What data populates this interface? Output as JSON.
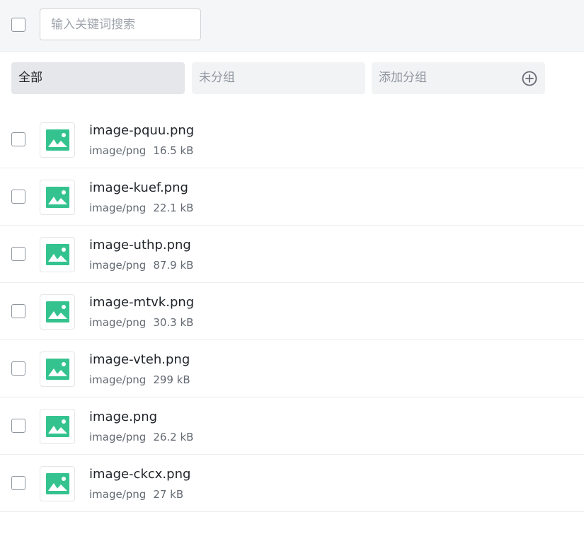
{
  "search": {
    "placeholder": "输入关键词搜索"
  },
  "groups": {
    "all_label": "全部",
    "ungrouped_label": "未分组",
    "add_label": "添加分组"
  },
  "colors": {
    "accent": "#34c38f",
    "active_tab_bg": "#e6e7ea",
    "tab_bg": "#f2f3f5"
  },
  "files": [
    {
      "name": "image-pquu.png",
      "type": "image/png",
      "size": "16.5 kB",
      "icon": "image-icon"
    },
    {
      "name": "image-kuef.png",
      "type": "image/png",
      "size": "22.1 kB",
      "icon": "image-icon"
    },
    {
      "name": "image-uthp.png",
      "type": "image/png",
      "size": "87.9 kB",
      "icon": "image-icon"
    },
    {
      "name": "image-mtvk.png",
      "type": "image/png",
      "size": "30.3 kB",
      "icon": "image-icon"
    },
    {
      "name": "image-vteh.png",
      "type": "image/png",
      "size": "299 kB",
      "icon": "image-icon"
    },
    {
      "name": "image.png",
      "type": "image/png",
      "size": "26.2 kB",
      "icon": "image-icon"
    },
    {
      "name": "image-ckcx.png",
      "type": "image/png",
      "size": "27 kB",
      "icon": "image-icon"
    }
  ]
}
